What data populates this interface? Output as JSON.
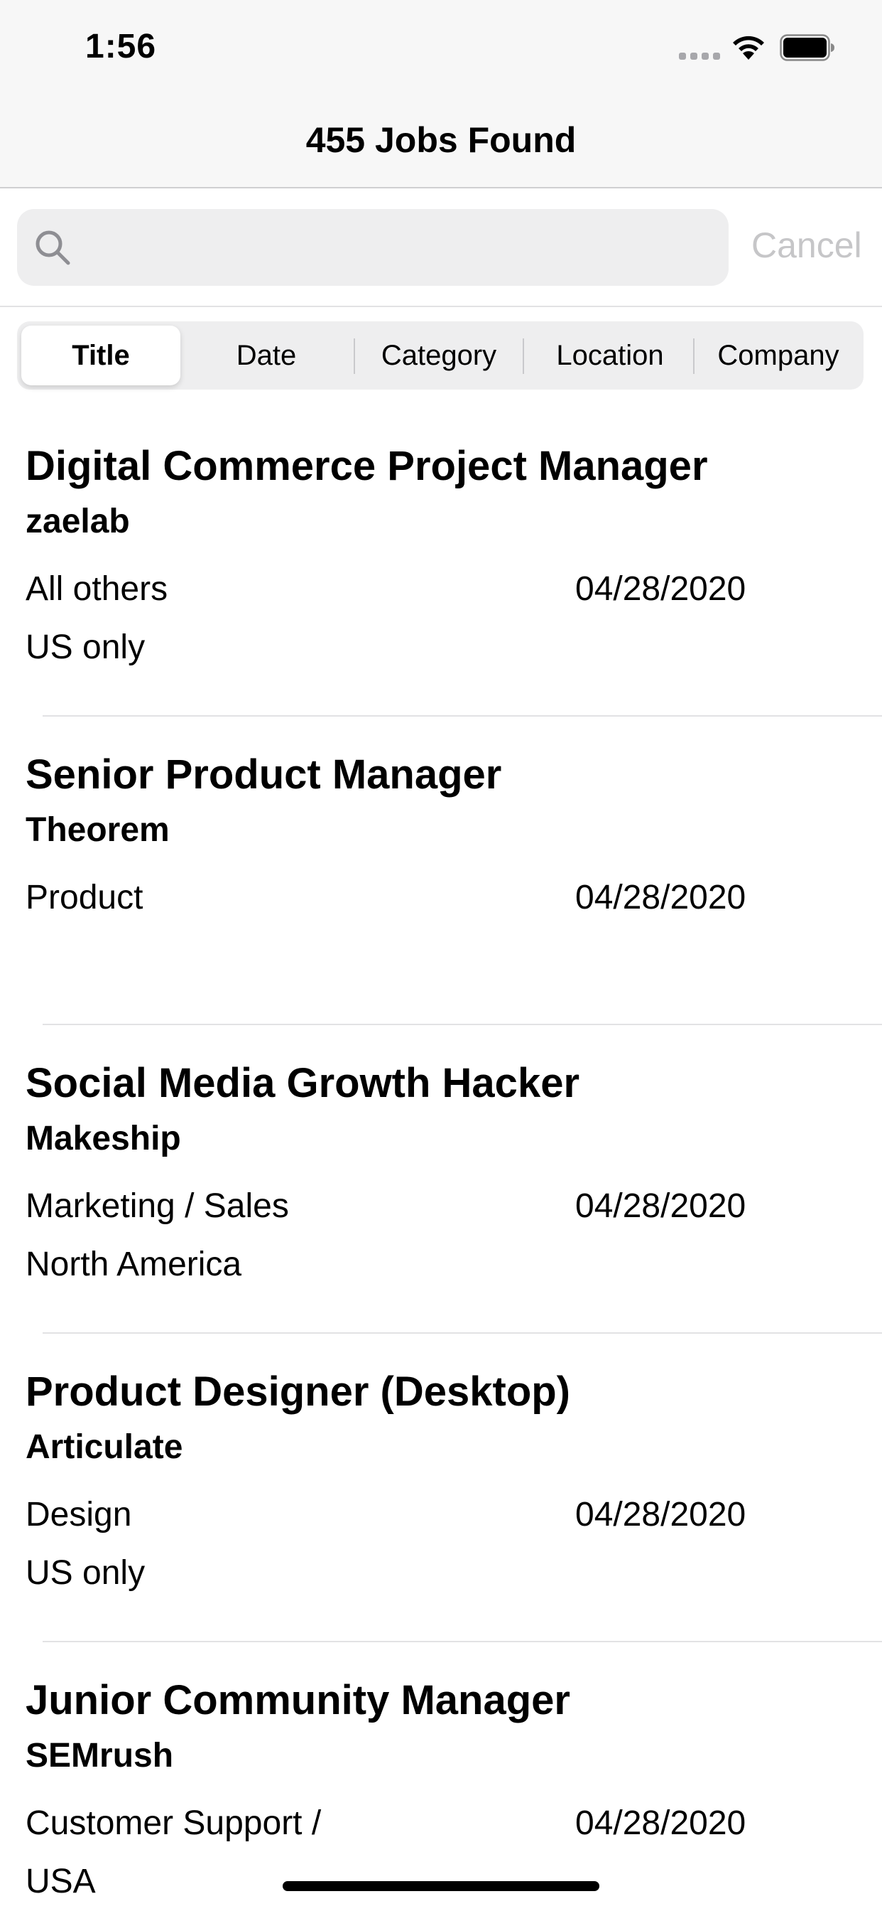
{
  "status_bar": {
    "time": "1:56",
    "icons": [
      "cellular-signal-icon",
      "wifi-icon",
      "battery-icon"
    ]
  },
  "nav": {
    "title": "455 Jobs Found"
  },
  "search": {
    "value": "",
    "placeholder": "",
    "cancel_label": "Cancel",
    "icon": "search-icon"
  },
  "sort_segments": {
    "items": [
      {
        "label": "Title",
        "selected": true
      },
      {
        "label": "Date",
        "selected": false
      },
      {
        "label": "Category",
        "selected": false
      },
      {
        "label": "Location",
        "selected": false
      },
      {
        "label": "Company",
        "selected": false
      }
    ]
  },
  "jobs": [
    {
      "title": "Digital Commerce Project Manager",
      "company": "zaelab",
      "category": "All others",
      "date": "04/28/2020",
      "location": "US only"
    },
    {
      "title": "Senior Product Manager",
      "company": "Theorem",
      "category": "Product",
      "date": "04/28/2020",
      "location": ""
    },
    {
      "title": "Social Media Growth Hacker",
      "company": "Makeship",
      "category": "Marketing / Sales",
      "date": "04/28/2020",
      "location": "North America"
    },
    {
      "title": "Product Designer (Desktop)",
      "company": "Articulate",
      "category": "Design",
      "date": "04/28/2020",
      "location": "US only"
    },
    {
      "title": "Junior Community Manager",
      "company": "SEMrush",
      "category": "Customer Support /",
      "date": "04/28/2020",
      "location": "USA"
    }
  ],
  "colors": {
    "header_bg": "#f7f7f7",
    "search_bg": "#eeeeef",
    "cancel_text": "#c6c6c8",
    "divider": "#e2e2e4"
  }
}
